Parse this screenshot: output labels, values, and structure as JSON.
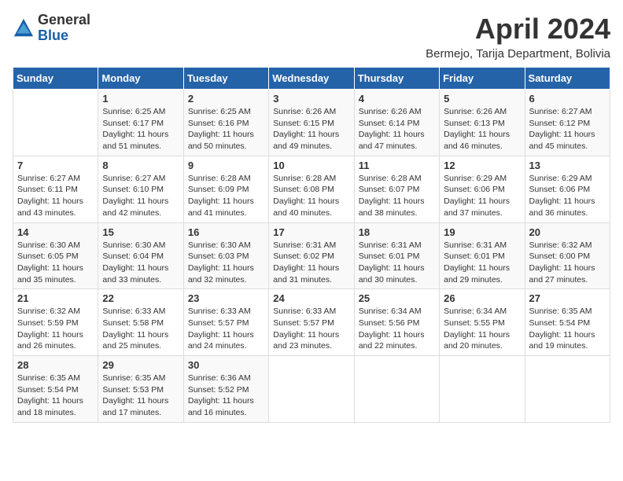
{
  "logo": {
    "general": "General",
    "blue": "Blue"
  },
  "title": "April 2024",
  "location": "Bermejo, Tarija Department, Bolivia",
  "days_of_week": [
    "Sunday",
    "Monday",
    "Tuesday",
    "Wednesday",
    "Thursday",
    "Friday",
    "Saturday"
  ],
  "weeks": [
    [
      {
        "day": "",
        "info": ""
      },
      {
        "day": "1",
        "info": "Sunrise: 6:25 AM\nSunset: 6:17 PM\nDaylight: 11 hours\nand 51 minutes."
      },
      {
        "day": "2",
        "info": "Sunrise: 6:25 AM\nSunset: 6:16 PM\nDaylight: 11 hours\nand 50 minutes."
      },
      {
        "day": "3",
        "info": "Sunrise: 6:26 AM\nSunset: 6:15 PM\nDaylight: 11 hours\nand 49 minutes."
      },
      {
        "day": "4",
        "info": "Sunrise: 6:26 AM\nSunset: 6:14 PM\nDaylight: 11 hours\nand 47 minutes."
      },
      {
        "day": "5",
        "info": "Sunrise: 6:26 AM\nSunset: 6:13 PM\nDaylight: 11 hours\nand 46 minutes."
      },
      {
        "day": "6",
        "info": "Sunrise: 6:27 AM\nSunset: 6:12 PM\nDaylight: 11 hours\nand 45 minutes."
      }
    ],
    [
      {
        "day": "7",
        "info": "Sunrise: 6:27 AM\nSunset: 6:11 PM\nDaylight: 11 hours\nand 43 minutes."
      },
      {
        "day": "8",
        "info": "Sunrise: 6:27 AM\nSunset: 6:10 PM\nDaylight: 11 hours\nand 42 minutes."
      },
      {
        "day": "9",
        "info": "Sunrise: 6:28 AM\nSunset: 6:09 PM\nDaylight: 11 hours\nand 41 minutes."
      },
      {
        "day": "10",
        "info": "Sunrise: 6:28 AM\nSunset: 6:08 PM\nDaylight: 11 hours\nand 40 minutes."
      },
      {
        "day": "11",
        "info": "Sunrise: 6:28 AM\nSunset: 6:07 PM\nDaylight: 11 hours\nand 38 minutes."
      },
      {
        "day": "12",
        "info": "Sunrise: 6:29 AM\nSunset: 6:06 PM\nDaylight: 11 hours\nand 37 minutes."
      },
      {
        "day": "13",
        "info": "Sunrise: 6:29 AM\nSunset: 6:06 PM\nDaylight: 11 hours\nand 36 minutes."
      }
    ],
    [
      {
        "day": "14",
        "info": "Sunrise: 6:30 AM\nSunset: 6:05 PM\nDaylight: 11 hours\nand 35 minutes."
      },
      {
        "day": "15",
        "info": "Sunrise: 6:30 AM\nSunset: 6:04 PM\nDaylight: 11 hours\nand 33 minutes."
      },
      {
        "day": "16",
        "info": "Sunrise: 6:30 AM\nSunset: 6:03 PM\nDaylight: 11 hours\nand 32 minutes."
      },
      {
        "day": "17",
        "info": "Sunrise: 6:31 AM\nSunset: 6:02 PM\nDaylight: 11 hours\nand 31 minutes."
      },
      {
        "day": "18",
        "info": "Sunrise: 6:31 AM\nSunset: 6:01 PM\nDaylight: 11 hours\nand 30 minutes."
      },
      {
        "day": "19",
        "info": "Sunrise: 6:31 AM\nSunset: 6:01 PM\nDaylight: 11 hours\nand 29 minutes."
      },
      {
        "day": "20",
        "info": "Sunrise: 6:32 AM\nSunset: 6:00 PM\nDaylight: 11 hours\nand 27 minutes."
      }
    ],
    [
      {
        "day": "21",
        "info": "Sunrise: 6:32 AM\nSunset: 5:59 PM\nDaylight: 11 hours\nand 26 minutes."
      },
      {
        "day": "22",
        "info": "Sunrise: 6:33 AM\nSunset: 5:58 PM\nDaylight: 11 hours\nand 25 minutes."
      },
      {
        "day": "23",
        "info": "Sunrise: 6:33 AM\nSunset: 5:57 PM\nDaylight: 11 hours\nand 24 minutes."
      },
      {
        "day": "24",
        "info": "Sunrise: 6:33 AM\nSunset: 5:57 PM\nDaylight: 11 hours\nand 23 minutes."
      },
      {
        "day": "25",
        "info": "Sunrise: 6:34 AM\nSunset: 5:56 PM\nDaylight: 11 hours\nand 22 minutes."
      },
      {
        "day": "26",
        "info": "Sunrise: 6:34 AM\nSunset: 5:55 PM\nDaylight: 11 hours\nand 20 minutes."
      },
      {
        "day": "27",
        "info": "Sunrise: 6:35 AM\nSunset: 5:54 PM\nDaylight: 11 hours\nand 19 minutes."
      }
    ],
    [
      {
        "day": "28",
        "info": "Sunrise: 6:35 AM\nSunset: 5:54 PM\nDaylight: 11 hours\nand 18 minutes."
      },
      {
        "day": "29",
        "info": "Sunrise: 6:35 AM\nSunset: 5:53 PM\nDaylight: 11 hours\nand 17 minutes."
      },
      {
        "day": "30",
        "info": "Sunrise: 6:36 AM\nSunset: 5:52 PM\nDaylight: 11 hours\nand 16 minutes."
      },
      {
        "day": "",
        "info": ""
      },
      {
        "day": "",
        "info": ""
      },
      {
        "day": "",
        "info": ""
      },
      {
        "day": "",
        "info": ""
      }
    ]
  ]
}
